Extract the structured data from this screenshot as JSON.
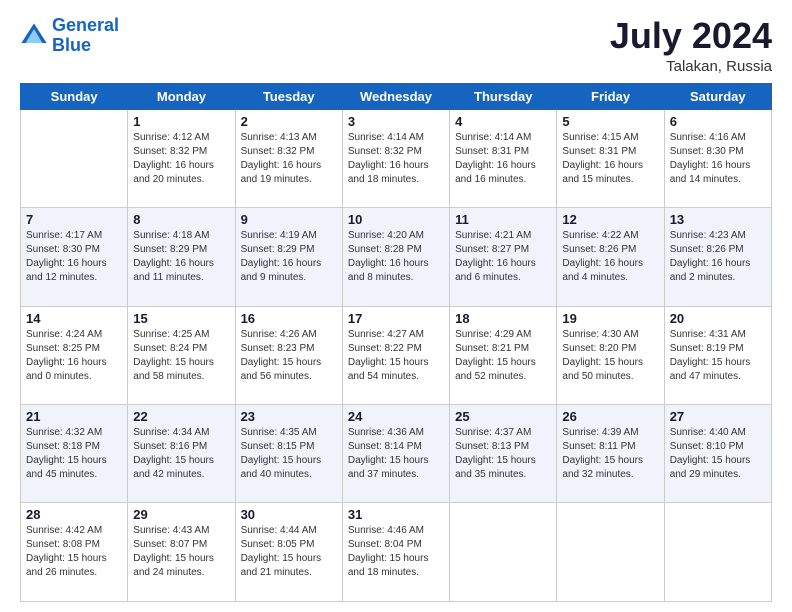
{
  "header": {
    "logo_line1": "General",
    "logo_line2": "Blue",
    "month": "July 2024",
    "location": "Talakan, Russia"
  },
  "days_of_week": [
    "Sunday",
    "Monday",
    "Tuesday",
    "Wednesday",
    "Thursday",
    "Friday",
    "Saturday"
  ],
  "weeks": [
    [
      {
        "day": "",
        "info": ""
      },
      {
        "day": "1",
        "info": "Sunrise: 4:12 AM\nSunset: 8:32 PM\nDaylight: 16 hours\nand 20 minutes."
      },
      {
        "day": "2",
        "info": "Sunrise: 4:13 AM\nSunset: 8:32 PM\nDaylight: 16 hours\nand 19 minutes."
      },
      {
        "day": "3",
        "info": "Sunrise: 4:14 AM\nSunset: 8:32 PM\nDaylight: 16 hours\nand 18 minutes."
      },
      {
        "day": "4",
        "info": "Sunrise: 4:14 AM\nSunset: 8:31 PM\nDaylight: 16 hours\nand 16 minutes."
      },
      {
        "day": "5",
        "info": "Sunrise: 4:15 AM\nSunset: 8:31 PM\nDaylight: 16 hours\nand 15 minutes."
      },
      {
        "day": "6",
        "info": "Sunrise: 4:16 AM\nSunset: 8:30 PM\nDaylight: 16 hours\nand 14 minutes."
      }
    ],
    [
      {
        "day": "7",
        "info": "Sunrise: 4:17 AM\nSunset: 8:30 PM\nDaylight: 16 hours\nand 12 minutes."
      },
      {
        "day": "8",
        "info": "Sunrise: 4:18 AM\nSunset: 8:29 PM\nDaylight: 16 hours\nand 11 minutes."
      },
      {
        "day": "9",
        "info": "Sunrise: 4:19 AM\nSunset: 8:29 PM\nDaylight: 16 hours\nand 9 minutes."
      },
      {
        "day": "10",
        "info": "Sunrise: 4:20 AM\nSunset: 8:28 PM\nDaylight: 16 hours\nand 8 minutes."
      },
      {
        "day": "11",
        "info": "Sunrise: 4:21 AM\nSunset: 8:27 PM\nDaylight: 16 hours\nand 6 minutes."
      },
      {
        "day": "12",
        "info": "Sunrise: 4:22 AM\nSunset: 8:26 PM\nDaylight: 16 hours\nand 4 minutes."
      },
      {
        "day": "13",
        "info": "Sunrise: 4:23 AM\nSunset: 8:26 PM\nDaylight: 16 hours\nand 2 minutes."
      }
    ],
    [
      {
        "day": "14",
        "info": "Sunrise: 4:24 AM\nSunset: 8:25 PM\nDaylight: 16 hours\nand 0 minutes."
      },
      {
        "day": "15",
        "info": "Sunrise: 4:25 AM\nSunset: 8:24 PM\nDaylight: 15 hours\nand 58 minutes."
      },
      {
        "day": "16",
        "info": "Sunrise: 4:26 AM\nSunset: 8:23 PM\nDaylight: 15 hours\nand 56 minutes."
      },
      {
        "day": "17",
        "info": "Sunrise: 4:27 AM\nSunset: 8:22 PM\nDaylight: 15 hours\nand 54 minutes."
      },
      {
        "day": "18",
        "info": "Sunrise: 4:29 AM\nSunset: 8:21 PM\nDaylight: 15 hours\nand 52 minutes."
      },
      {
        "day": "19",
        "info": "Sunrise: 4:30 AM\nSunset: 8:20 PM\nDaylight: 15 hours\nand 50 minutes."
      },
      {
        "day": "20",
        "info": "Sunrise: 4:31 AM\nSunset: 8:19 PM\nDaylight: 15 hours\nand 47 minutes."
      }
    ],
    [
      {
        "day": "21",
        "info": "Sunrise: 4:32 AM\nSunset: 8:18 PM\nDaylight: 15 hours\nand 45 minutes."
      },
      {
        "day": "22",
        "info": "Sunrise: 4:34 AM\nSunset: 8:16 PM\nDaylight: 15 hours\nand 42 minutes."
      },
      {
        "day": "23",
        "info": "Sunrise: 4:35 AM\nSunset: 8:15 PM\nDaylight: 15 hours\nand 40 minutes."
      },
      {
        "day": "24",
        "info": "Sunrise: 4:36 AM\nSunset: 8:14 PM\nDaylight: 15 hours\nand 37 minutes."
      },
      {
        "day": "25",
        "info": "Sunrise: 4:37 AM\nSunset: 8:13 PM\nDaylight: 15 hours\nand 35 minutes."
      },
      {
        "day": "26",
        "info": "Sunrise: 4:39 AM\nSunset: 8:11 PM\nDaylight: 15 hours\nand 32 minutes."
      },
      {
        "day": "27",
        "info": "Sunrise: 4:40 AM\nSunset: 8:10 PM\nDaylight: 15 hours\nand 29 minutes."
      }
    ],
    [
      {
        "day": "28",
        "info": "Sunrise: 4:42 AM\nSunset: 8:08 PM\nDaylight: 15 hours\nand 26 minutes."
      },
      {
        "day": "29",
        "info": "Sunrise: 4:43 AM\nSunset: 8:07 PM\nDaylight: 15 hours\nand 24 minutes."
      },
      {
        "day": "30",
        "info": "Sunrise: 4:44 AM\nSunset: 8:05 PM\nDaylight: 15 hours\nand 21 minutes."
      },
      {
        "day": "31",
        "info": "Sunrise: 4:46 AM\nSunset: 8:04 PM\nDaylight: 15 hours\nand 18 minutes."
      },
      {
        "day": "",
        "info": ""
      },
      {
        "day": "",
        "info": ""
      },
      {
        "day": "",
        "info": ""
      }
    ]
  ]
}
